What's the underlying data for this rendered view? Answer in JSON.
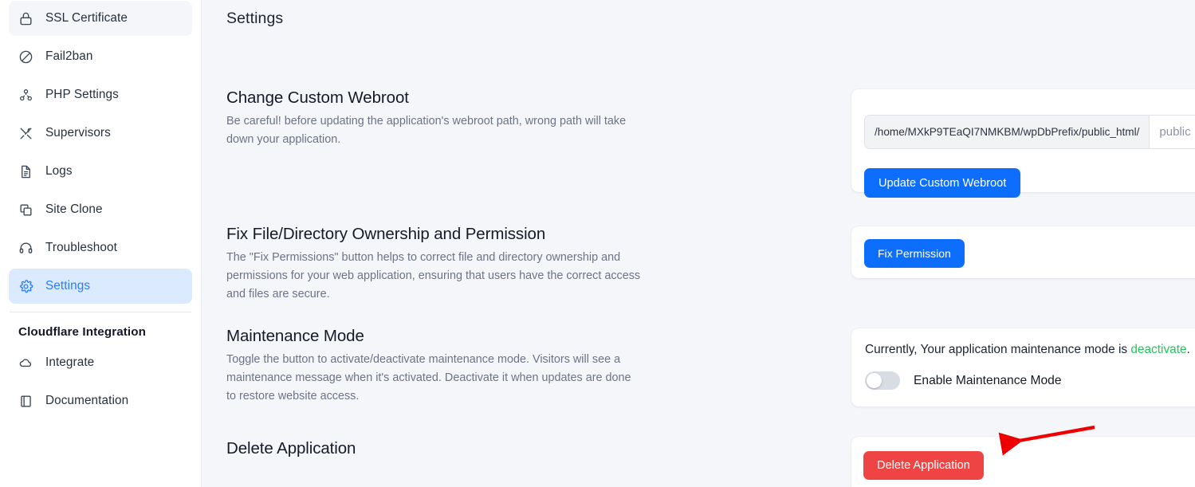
{
  "sidebar": {
    "items": [
      {
        "label": "SSL Certificate",
        "icon": "lock-icon",
        "state": "hovered"
      },
      {
        "label": "Fail2ban",
        "icon": "ban-icon",
        "state": "normal"
      },
      {
        "label": "PHP Settings",
        "icon": "nodes-icon",
        "state": "normal"
      },
      {
        "label": "Supervisors",
        "icon": "tools-icon",
        "state": "normal"
      },
      {
        "label": "Logs",
        "icon": "document-icon",
        "state": "normal"
      },
      {
        "label": "Site Clone",
        "icon": "copy-icon",
        "state": "normal"
      },
      {
        "label": "Troubleshoot",
        "icon": "headset-icon",
        "state": "normal"
      },
      {
        "label": "Settings",
        "icon": "gear-icon",
        "state": "active"
      }
    ],
    "section_heading": "Cloudflare Integration",
    "section_items": [
      {
        "label": "Integrate",
        "icon": "cloud-icon",
        "state": "normal"
      },
      {
        "label": "Documentation",
        "icon": "book-icon",
        "state": "normal"
      }
    ]
  },
  "main": {
    "page_title": "Settings",
    "webroot": {
      "title": "Change Custom Webroot",
      "description": "Be careful! before updating the application's webroot path, wrong path will take down your application.",
      "path_prefix": "/home/MXkP9TEaQI7NMKBM/wpDbPrefix/public_html/",
      "input_value": "",
      "input_placeholder": "public",
      "button_label": "Update Custom Webroot"
    },
    "permissions": {
      "title": "Fix File/Directory Ownership and Permission",
      "description": "The \"Fix Permissions\" button helps to correct file and directory ownership and permissions for your web application, ensuring that users have the correct access and files are secure.",
      "button_label": "Fix Permission"
    },
    "maintenance": {
      "title": "Maintenance Mode",
      "description": "Toggle the button to activate/deactivate maintenance mode. Visitors will see a maintenance message when it's activated. Deactivate it when updates are done to restore website access.",
      "status_prefix": "Currently, Your application maintenance mode is ",
      "status_value": "deactivate",
      "status_suffix": ".",
      "toggle_label": "Enable Maintenance Mode",
      "toggle_on": false
    },
    "delete": {
      "title": "Delete Application",
      "button_label": "Delete Application"
    }
  },
  "annotation": {
    "arrow_color": "#ef0000",
    "points_to": "delete-application-button"
  },
  "colors": {
    "accent_blue": "#0d6efd",
    "active_nav_bg": "#dbeafe",
    "active_nav_text": "#2f7bf6",
    "danger_red": "#ef4444",
    "success_green": "#22c55e",
    "page_bg": "#f5f6fa"
  }
}
